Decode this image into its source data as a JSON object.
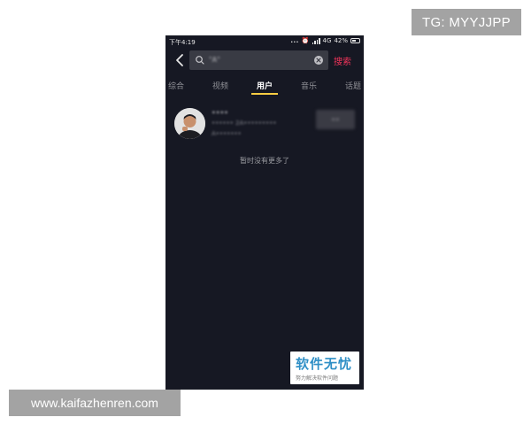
{
  "overlays": {
    "tg_label": "TG: MYYJJPP",
    "site_label": "www.kaifazhenren.com"
  },
  "status_bar": {
    "time": "下午4:19",
    "dots": "...",
    "network": "4G",
    "battery": "42%"
  },
  "search": {
    "query": "\"A\"",
    "search_label": "搜索",
    "back_icon": "back-arrow-icon",
    "clear_icon": "clear-circle-icon"
  },
  "tabs": [
    {
      "label": "综合",
      "active": false
    },
    {
      "label": "视频",
      "active": false
    },
    {
      "label": "用户",
      "active": true
    },
    {
      "label": "音乐",
      "active": false
    },
    {
      "label": "话题",
      "active": false
    }
  ],
  "results": {
    "user": {
      "name": "••••",
      "id_line": "•••••• 2A•••••••••",
      "fans_line": "A•••••••",
      "follow_label": "••"
    },
    "end_text": "暂时没有更多了"
  },
  "watermark": {
    "title": "软件无忧",
    "subtitle": "努力解决软件问题"
  },
  "colors": {
    "background": "#161823",
    "accent": "#f0345a",
    "tab_indicator": "#facd43"
  }
}
